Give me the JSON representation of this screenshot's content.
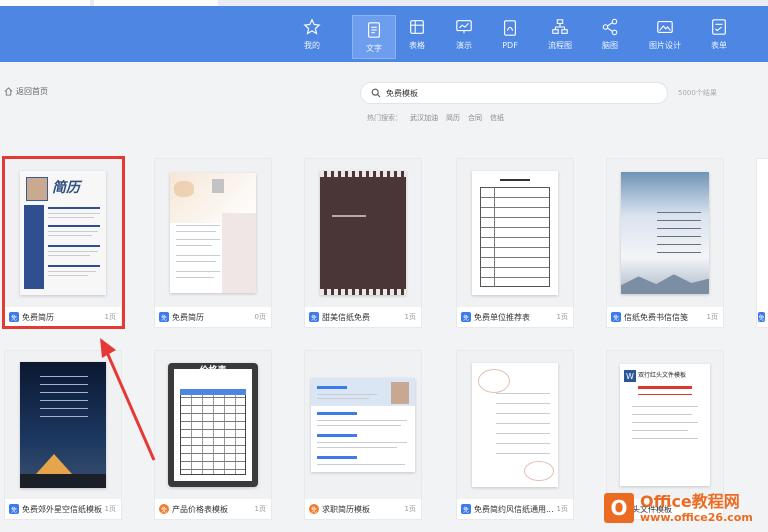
{
  "nav": {
    "items": [
      {
        "label": "我的",
        "icon": "star-icon"
      },
      {
        "label": "文字",
        "icon": "document-icon",
        "active": true
      },
      {
        "label": "表格",
        "icon": "table-icon"
      },
      {
        "label": "演示",
        "icon": "presentation-icon"
      },
      {
        "label": "PDF",
        "icon": "pdf-icon"
      },
      {
        "label": "流程图",
        "icon": "flowchart-icon"
      },
      {
        "label": "脑图",
        "icon": "mindmap-icon"
      },
      {
        "label": "图片设计",
        "icon": "image-design-icon"
      },
      {
        "label": "表单",
        "icon": "form-icon"
      }
    ]
  },
  "back_label": "返回首页",
  "search": {
    "value": "免费模板",
    "result_count": "5000个结果"
  },
  "hot": {
    "label": "热门搜索：",
    "tags": [
      "武汉加油",
      "简历",
      "合同",
      "信纸"
    ]
  },
  "jianli_title": "简历",
  "price_sheet_title": "价格表",
  "redhead_title": "双行红头文件模板",
  "cards": [
    {
      "title": "免费简历",
      "pages": "1页",
      "badge": "免"
    },
    {
      "title": "免费简历",
      "pages": "0页",
      "badge": "免"
    },
    {
      "title": "甜美信纸免费",
      "pages": "1页",
      "badge": "免"
    },
    {
      "title": "免费单位推荐表",
      "pages": "1页",
      "badge": "免"
    },
    {
      "title": "信纸免费书信信笺",
      "pages": "1页",
      "badge": "免"
    },
    {
      "title": "免费郊外星空信纸模板",
      "pages": "1页",
      "badge": "免"
    },
    {
      "title": "产品价格表模板",
      "pages": "1页",
      "badge": "免"
    },
    {
      "title": "求职简历模板",
      "pages": "1页",
      "badge": "免"
    },
    {
      "title": "免费简约风信纸通用...",
      "pages": "1页",
      "badge": "免"
    },
    {
      "title": "红头文件模板",
      "pages": "",
      "badge": "免"
    }
  ],
  "logo": {
    "letter": "O",
    "line1": "Office教程网",
    "line2": "www.office26.com"
  },
  "colors": {
    "nav": "#4e86e4",
    "accent": "#3d7be8",
    "highlight": "#e53935",
    "logo": "#ec6b23"
  }
}
